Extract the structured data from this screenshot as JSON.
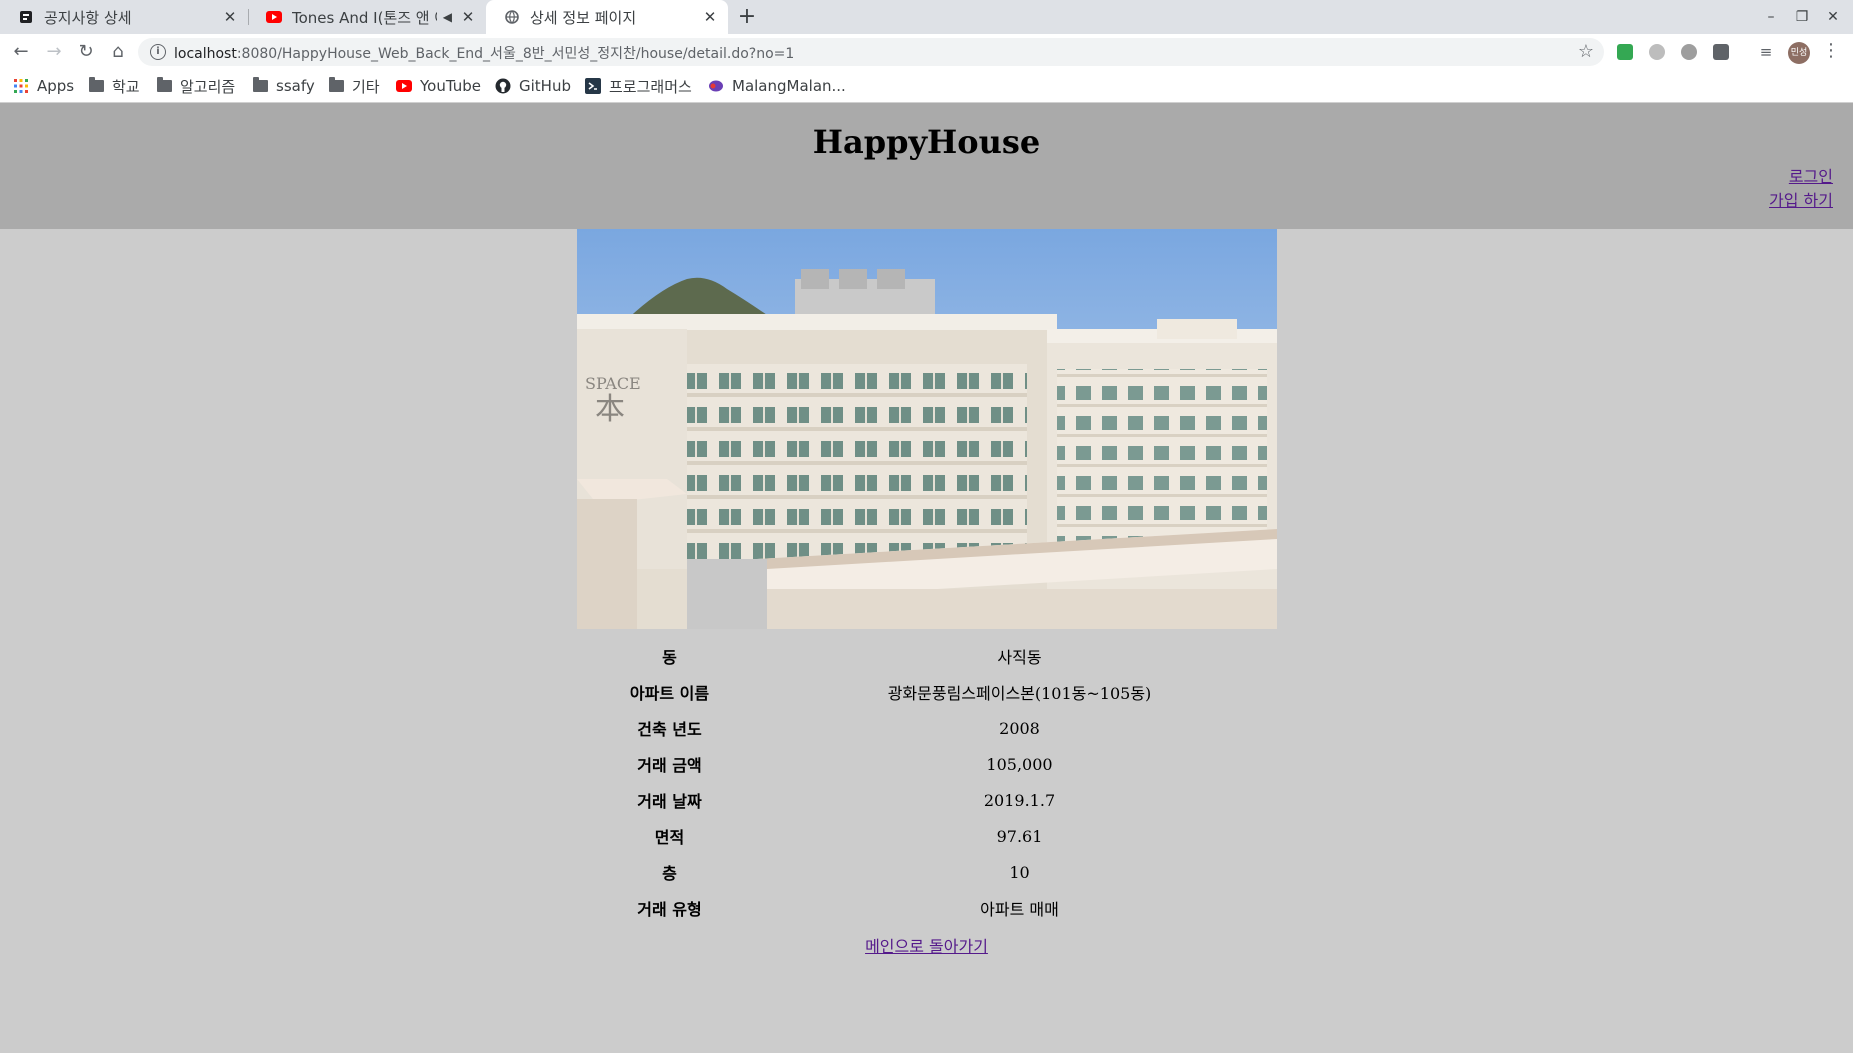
{
  "browser": {
    "tabs": [
      {
        "title": "공지사항 상세",
        "active": false,
        "favicon": "notice-favicon-icon"
      },
      {
        "title": "Tones And I(톤즈 앤 아이)",
        "active": false,
        "favicon": "youtube-icon",
        "audio": true
      },
      {
        "title": "상세 정보 페이지",
        "active": true,
        "favicon": "globe-icon"
      }
    ],
    "url_host": "localhost",
    "url_path": ":8080/HappyHouse_Web_Back_End_서울_8반_서민성_정지찬/house/detail.do?no=1",
    "profile_initials": "민성",
    "bookmarks": [
      {
        "label": "Apps",
        "icon": "apps-grid-icon"
      },
      {
        "label": "학교",
        "icon": "folder-icon"
      },
      {
        "label": "알고리즘",
        "icon": "folder-icon"
      },
      {
        "label": "ssafy",
        "icon": "folder-icon"
      },
      {
        "label": "기타",
        "icon": "folder-icon"
      },
      {
        "label": "YouTube",
        "icon": "youtube-icon"
      },
      {
        "label": "GitHub",
        "icon": "github-icon"
      },
      {
        "label": "프로그래머스",
        "icon": "programmers-icon"
      },
      {
        "label": "MalangMalan...",
        "icon": "malang-icon"
      }
    ]
  },
  "header": {
    "title": "HappyHouse",
    "login": "로그인",
    "signup": "가입 하기"
  },
  "house": {
    "image_alt": "apartment photo",
    "rows": [
      {
        "label": "동",
        "value": "사직동"
      },
      {
        "label": "아파트 이름",
        "value": "광화문풍림스페이스본(101동~105동)"
      },
      {
        "label": "건축 년도",
        "value": "2008"
      },
      {
        "label": "거래 금액",
        "value": "105,000"
      },
      {
        "label": "거래 날짜",
        "value": "2019.1.7"
      },
      {
        "label": "면적",
        "value": "97.61"
      },
      {
        "label": "층",
        "value": "10"
      },
      {
        "label": "거래 유형",
        "value": "아파트 매매"
      }
    ]
  },
  "footer": {
    "back_link": "메인으로 돌아가기"
  },
  "colors": {
    "header_bg": "#aaaaaa",
    "page_bg": "#cccccc",
    "link": "#551a8b"
  }
}
